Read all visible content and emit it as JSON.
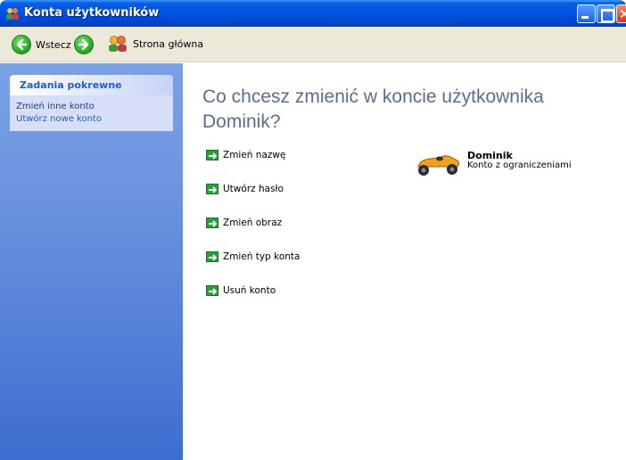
{
  "window": {
    "title": "Konta użytkowników"
  },
  "toolbar": {
    "back_label": "Wstecz",
    "home_label": "Strona główna"
  },
  "sidebar": {
    "panel_title": "Zadania pokrewne",
    "links": [
      "Zmień inne konto",
      "Utwórz nowe konto"
    ]
  },
  "main": {
    "heading": "Co chcesz zmienić w koncie użytkownika Dominik?",
    "actions": [
      "Zmień nazwę",
      "Utwórz hasło",
      "Zmień obraz",
      "Zmień typ konta",
      "Usuń konto"
    ]
  },
  "user": {
    "name": "Dominik",
    "account_type": "Konto z ograniczeniami",
    "picture": "race-car-icon"
  },
  "colors": {
    "titlebar": "#0054e3",
    "sidebar": "#6d95e0",
    "link": "#215dc6",
    "heading": "#5a6e8c",
    "action_arrow": "#2e9e3a"
  }
}
